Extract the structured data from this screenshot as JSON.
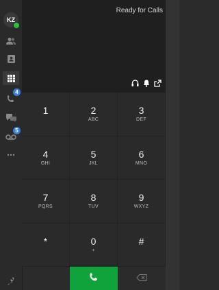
{
  "user": {
    "initials": "KZ",
    "presence_color": "#2fbf3a"
  },
  "status": {
    "text": "Ready for Calls"
  },
  "rail": {
    "items": [
      {
        "name": "contacts",
        "icon": "contacts-icon"
      },
      {
        "name": "directory",
        "icon": "directory-icon"
      },
      {
        "name": "dialpad",
        "icon": "dialpad-icon",
        "active": true
      },
      {
        "name": "call-history",
        "icon": "call-history-icon",
        "badge": "4"
      },
      {
        "name": "chat",
        "icon": "chat-icon"
      },
      {
        "name": "voicemail",
        "icon": "voicemail-icon",
        "badge": "5"
      },
      {
        "name": "more",
        "icon": "more-icon"
      },
      {
        "name": "settings",
        "icon": "wrench-icon"
      }
    ]
  },
  "keypad": {
    "keys": [
      {
        "digit": "1",
        "letters": ""
      },
      {
        "digit": "2",
        "letters": "ABC"
      },
      {
        "digit": "3",
        "letters": "DEF"
      },
      {
        "digit": "4",
        "letters": "GHI"
      },
      {
        "digit": "5",
        "letters": "JKL"
      },
      {
        "digit": "6",
        "letters": "MNO"
      },
      {
        "digit": "7",
        "letters": "PQRS"
      },
      {
        "digit": "8",
        "letters": "TUV"
      },
      {
        "digit": "9",
        "letters": "WXYZ"
      },
      {
        "digit": "*",
        "letters": ""
      },
      {
        "digit": "0",
        "letters": "+"
      },
      {
        "digit": "#",
        "letters": ""
      }
    ]
  },
  "actions": {
    "call_icon": "phone-icon",
    "backspace_icon": "backspace-icon"
  },
  "colors": {
    "accent": "#10a33b",
    "badge": "#3a7fd5"
  }
}
